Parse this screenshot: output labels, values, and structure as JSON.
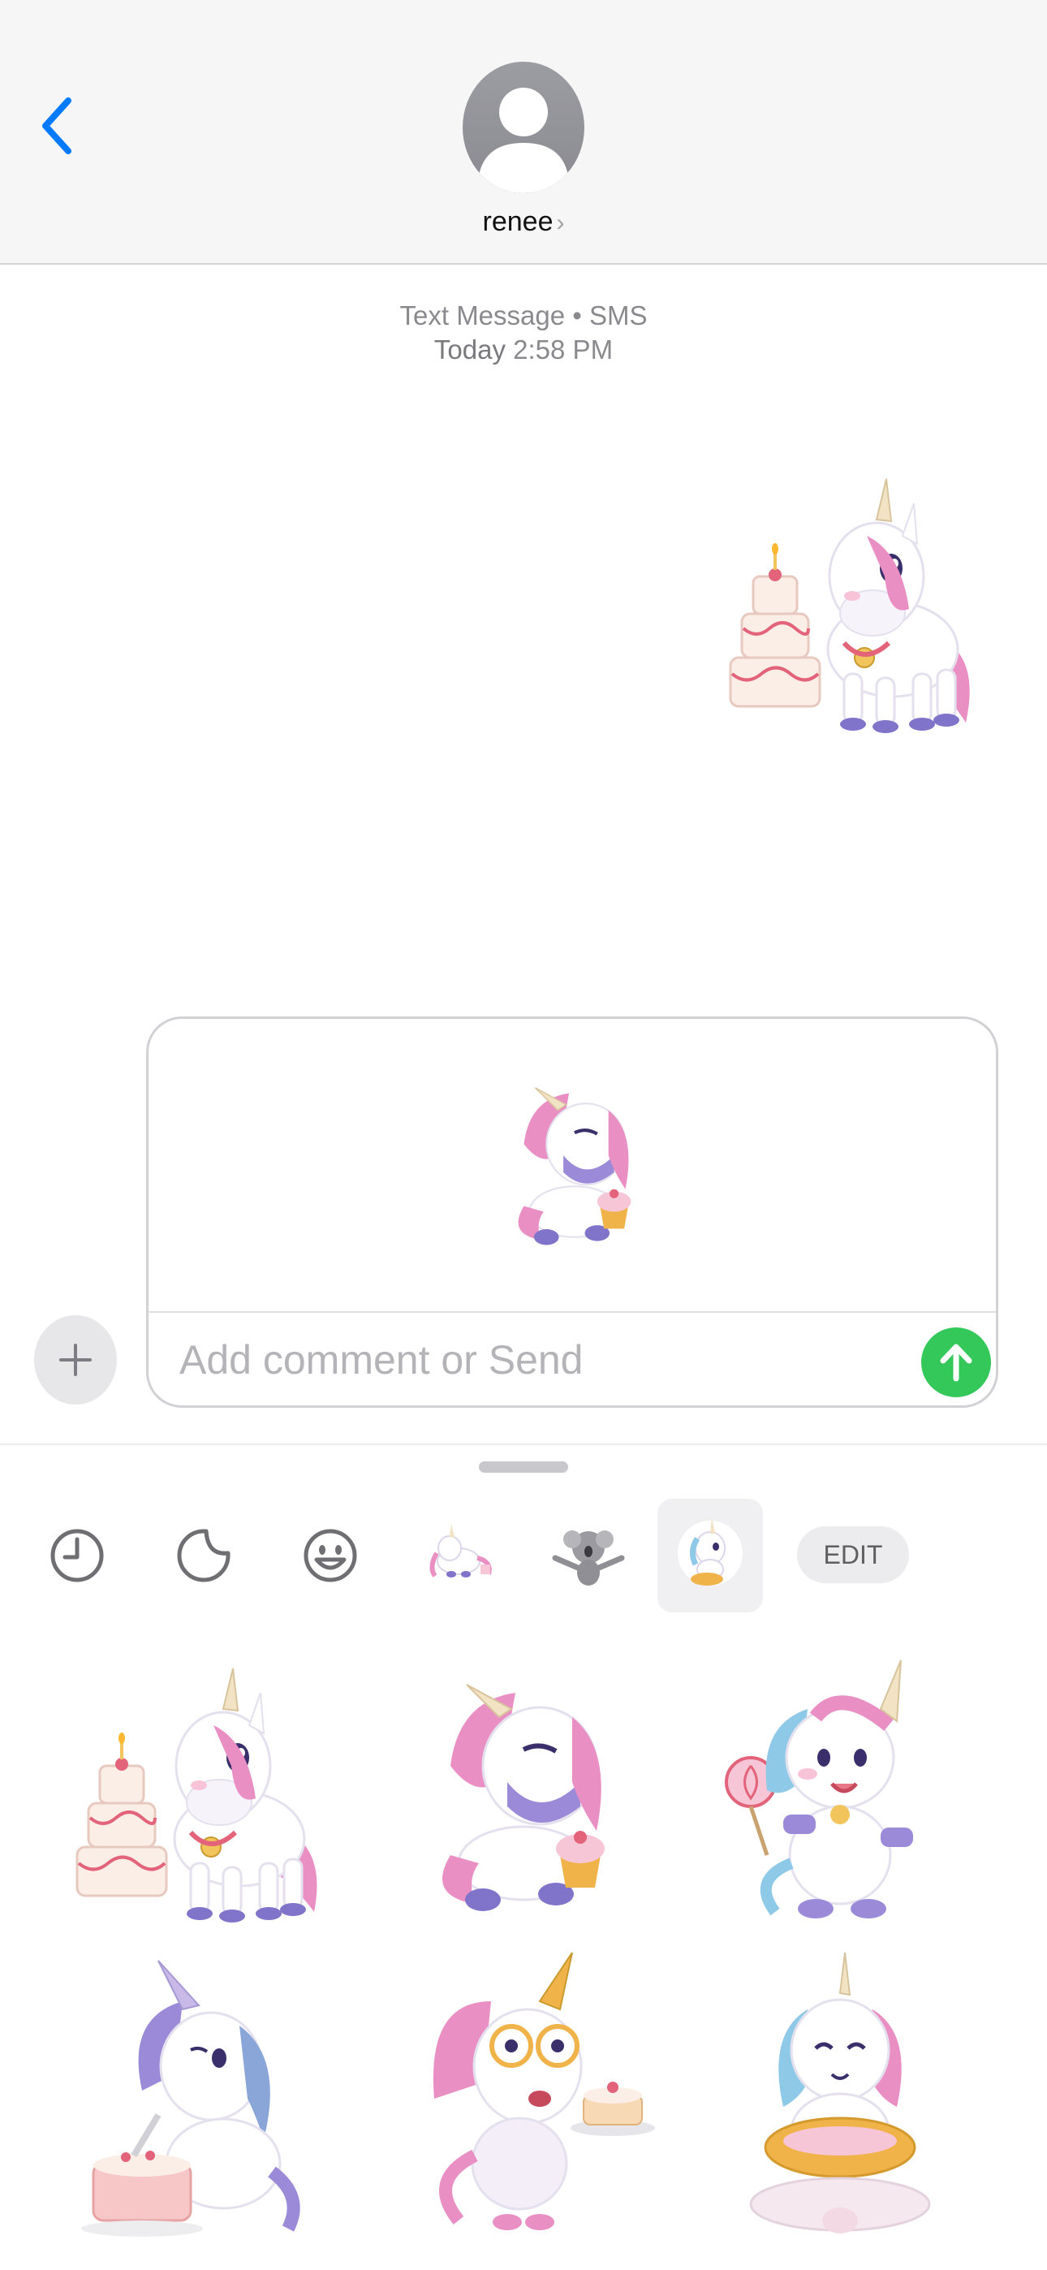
{
  "header": {
    "contact_name": "renee",
    "back_icon": "chevron-left-icon",
    "avatar_icon": "person-silhouette-icon"
  },
  "conversation": {
    "service_label": "Text Message • SMS",
    "date_prefix": "Today",
    "time": "2:58 PM",
    "sent_sticker": "unicorn-with-cake-sticker"
  },
  "compose": {
    "placeholder": "Add comment or Send",
    "preview_sticker": "unicorn-with-cupcake-sticker",
    "plus_icon": "plus-icon",
    "send_icon": "arrow-up-icon"
  },
  "drawer": {
    "tabs": [
      {
        "name": "recents",
        "icon": "clock-icon"
      },
      {
        "name": "stickers",
        "icon": "sticker-peel-icon"
      },
      {
        "name": "emoji",
        "icon": "smiley-icon"
      },
      {
        "name": "unicorn-pack-1",
        "icon": "flying-unicorn-thumbnail"
      },
      {
        "name": "koala-pack",
        "icon": "koala-thumbnail"
      },
      {
        "name": "unicorn-pack-2",
        "icon": "unicorn-thumbnail",
        "selected": true
      }
    ],
    "edit_label": "EDIT",
    "stickers": [
      "unicorn-with-cake-sticker",
      "unicorn-with-cupcake-sticker",
      "unicorn-with-lollipop-sticker",
      "unicorn-cutting-cake-sticker",
      "unicorn-with-glasses-sticker",
      "unicorn-meditating-sticker"
    ]
  },
  "colors": {
    "ios_blue": "#007aff",
    "send_green": "#34c759",
    "unicorn_pink": "#e98fc4",
    "unicorn_purple": "#9b8ad8",
    "unicorn_blue": "#8fc9e8"
  }
}
